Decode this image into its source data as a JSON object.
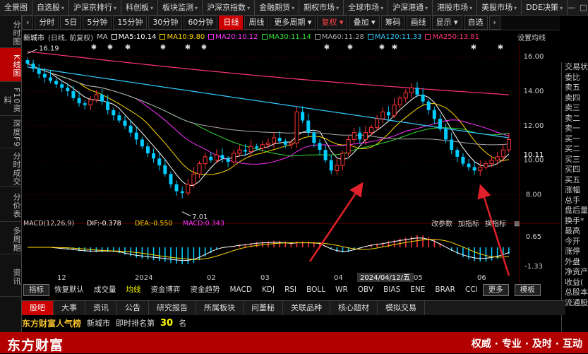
{
  "topnav": [
    "全景图",
    "自选股",
    "沪深京排行",
    "科创板",
    "板块监测",
    "沪深京指数",
    "金融期货",
    "期权市场",
    "全球市场",
    "沪深港通",
    "港股市场",
    "美股市场",
    "DDE决策"
  ],
  "window_controls": [
    "—",
    "□",
    "✕"
  ],
  "sidebar": [
    "分时图",
    "K线图",
    "F10资料",
    "深度F9",
    "分时成交",
    "分价表",
    "多周期",
    "资讯"
  ],
  "toolbar": {
    "buttons": [
      "分时",
      "5日",
      "5分钟",
      "15分钟",
      "30分钟",
      "60分钟",
      "日线",
      "周线",
      "更多周期",
      "复权",
      "叠加",
      "筹码",
      "画线",
      "显示",
      "自选"
    ],
    "nav_arrows": [
      "‹",
      "›"
    ]
  },
  "infoline": {
    "stock": "新城市",
    "adjust": "(日线, 前复权)",
    "mas": [
      {
        "label": "MA5:10.14",
        "color": "#ffffff"
      },
      {
        "label": "MA10:9.80",
        "color": "#ffd700"
      },
      {
        "label": "MA20:10.12",
        "color": "#ff33ff"
      },
      {
        "label": "MA30:11.14",
        "color": "#33dd33"
      },
      {
        "label": "MA60:11.28",
        "color": "#aaaaaa"
      },
      {
        "label": "MA120:11.33",
        "color": "#33ccff"
      },
      {
        "label": "MA250:13.81",
        "color": "#ff3377"
      }
    ],
    "settings": "设置均线"
  },
  "kline_chart": {
    "y_ticks": [
      "16.00",
      "14.00",
      "12.00",
      "10.11",
      "10.00",
      "8.00"
    ],
    "high_label": "16.19",
    "low_label": "7.01",
    "current_price": "10.11"
  },
  "macd_panel": {
    "title": "MACD(12,26,9)",
    "dif": "DIF:-0.378",
    "dea": "DEA:-0.550",
    "macd": "MACD:0.343",
    "actions": [
      "改参数",
      "加指标",
      "换指标"
    ],
    "y_ticks": [
      "0.65",
      "-1.33"
    ]
  },
  "x_axis": {
    "labels": [
      "12",
      "2024",
      "02",
      "03",
      "04",
      "05",
      "06"
    ],
    "cursor_date": "2024/04/12/五"
  },
  "right_panel": [
    "交易状",
    "委比",
    "",
    "卖五",
    "卖四",
    "卖三",
    "卖二",
    "卖一",
    "买一",
    "买二",
    "买三",
    "买四",
    "买五",
    "涨幅",
    "总手",
    "盘后量",
    "换手*",
    "最高",
    "今开",
    "涨停",
    "外盘",
    "净资产",
    "收益(",
    "总股本",
    "流通股"
  ],
  "indicator_tabs": [
    "指标",
    "恢复默认",
    "成交量",
    "均线",
    "资金博弈",
    "资金趋势",
    "MACD",
    "KDJ",
    "RSI",
    "BOLL",
    "WR",
    "OBV",
    "BIAS",
    "ENE",
    "BRAR",
    "CCI",
    "更多",
    "模板"
  ],
  "info_tabs": [
    "股吧",
    "大事",
    "资讯",
    "公告",
    "研究报告",
    "所属板块",
    "问董秘",
    "关联品种",
    "核心题材",
    "模拟交易"
  ],
  "rank_row": {
    "brand": "东方财富人气榜",
    "stock": "新城市",
    "text": "即时排名第",
    "rank": "30",
    "unit": "名"
  },
  "bottom": {
    "logo": "东方财富",
    "slogan": "权威 · 专业 · 及时 · 互动"
  },
  "colors": {
    "up": "#ff3333",
    "down": "#00ccff",
    "brand_red": "#b30000"
  },
  "chart_data": {
    "type": "candlestick",
    "x_range": [
      "2023-12",
      "2024-06"
    ],
    "close": [
      15.6,
      15.3,
      15.0,
      14.8,
      14.6,
      14.4,
      14.2,
      14.0,
      13.6,
      13.3,
      13.2,
      13.5,
      13.8,
      13.4,
      12.9,
      12.6,
      12.3,
      12.0,
      11.6,
      11.2,
      10.8,
      10.4,
      10.1,
      9.7,
      9.2,
      8.6,
      8.2,
      8.1,
      8.6,
      9.2,
      9.8,
      10.2,
      10.0,
      10.3,
      10.1,
      9.9,
      10.4,
      10.6,
      10.5,
      10.8,
      10.7,
      10.9,
      11.0,
      11.3,
      11.1,
      10.9,
      11.0,
      12.8,
      12.3,
      11.6,
      11.0,
      10.6,
      10.0,
      9.4,
      9.7,
      10.4,
      11.2,
      11.6,
      11.2,
      11.6,
      11.9,
      12.4,
      12.8,
      12.6,
      13.2,
      13.6,
      13.9,
      14.2,
      13.8,
      13.4,
      12.9,
      12.4,
      11.8,
      11.2,
      10.6,
      10.2,
      9.8,
      9.6,
      9.4,
      9.6,
      9.8,
      10.0,
      10.2,
      10.6,
      11.2
    ],
    "y_range": [
      7,
      16.5
    ],
    "high": 16.19,
    "low": 7.01,
    "macd_dif": -0.378,
    "macd_dea": -0.55,
    "macd_hist": 0.343
  }
}
